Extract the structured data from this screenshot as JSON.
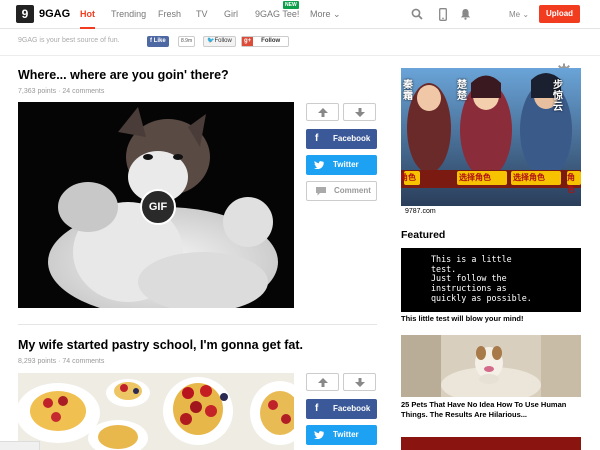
{
  "topbar": {
    "logo_mark": "9",
    "logo_text": "9GAG",
    "nav": [
      "Hot",
      "Trending",
      "Fresh",
      "TV",
      "Girl",
      "9GAG Tee!",
      "More ⌄"
    ],
    "new_badge": "NEW",
    "me": "Me ⌄",
    "upload": "Upload",
    "icons": [
      "search-icon",
      "mobile-icon",
      "notification-bell-icon"
    ]
  },
  "subbar": {
    "tagline": "9GAG is your best source of fun.",
    "fb_like": "f Like",
    "fb_count": "8.9m",
    "tw_follow": "Follow",
    "gp_g": "g+",
    "gp_follow": "Follow"
  },
  "posts": [
    {
      "title": "Where... where are you goin' there?",
      "meta": "7,363 points · 24 comments",
      "badge": "GIF"
    },
    {
      "title": "My wife started pastry school, I'm gonna get fat.",
      "meta": "8,293 points · 74 comments"
    }
  ],
  "share": {
    "facebook": "Facebook",
    "twitter": "Twitter",
    "comment": "Comment"
  },
  "sidebar": {
    "ad_footer": "9787.com",
    "ad_labels": [
      "秦霜",
      "楚楚",
      "步惊云"
    ],
    "ad_buttons": [
      "角色",
      "选择角色",
      "选择角色",
      "角色"
    ],
    "featured_heading": "Featured",
    "feat1_text": "This is a little\ntest.\nJust follow the\ninstructions as\nquickly as possible.",
    "feat1_caption": "This little test will blow your mind!",
    "feat2_caption": "25 Pets That Have No Idea How To Use Human Things. The Results Are Hilarious..."
  },
  "colors": {
    "accent": "#f23c1f",
    "facebook": "#3b5998",
    "twitter": "#1da1f2",
    "new_badge": "#0d9f4b"
  }
}
